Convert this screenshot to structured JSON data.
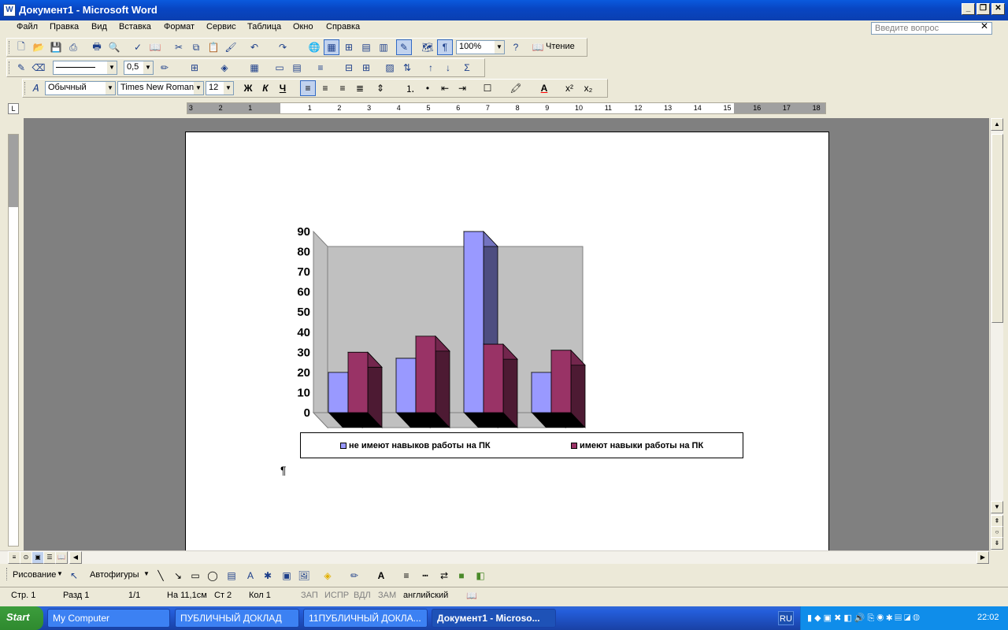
{
  "window": {
    "title": "Документ1 - Microsoft Word",
    "app_icon": "W"
  },
  "menu": [
    "Файл",
    "Правка",
    "Вид",
    "Вставка",
    "Формат",
    "Сервис",
    "Таблица",
    "Окно",
    "Справка"
  ],
  "help_search": {
    "placeholder": "Введите вопрос"
  },
  "toolbar_standard": {
    "zoom": "100%",
    "reading_label": "Чтение"
  },
  "toolbar_tables": {
    "line_weight": "0,5"
  },
  "toolbar_format": {
    "style": "Обычный",
    "font": "Times New Roman",
    "size": "12",
    "bold": "Ж",
    "italic": "К",
    "underline": "Ч"
  },
  "ruler_h_labels": [
    "3",
    "2",
    "1",
    "1",
    "2",
    "3",
    "4",
    "5",
    "6",
    "7",
    "8",
    "9",
    "10",
    "11",
    "12",
    "13",
    "14",
    "15",
    "16",
    "17",
    "18"
  ],
  "chart_data": {
    "type": "bar",
    "categories": [
      "",
      "",
      "",
      ""
    ],
    "series": [
      {
        "name": "не имеют навыков работы на ПК",
        "values": [
          20,
          27,
          90,
          20
        ],
        "color": "#9999ff"
      },
      {
        "name": "имеют навыки работы на ПК",
        "values": [
          30,
          38,
          34,
          31
        ],
        "color": "#993366"
      }
    ],
    "ylim": [
      0,
      90
    ],
    "yticks": [
      "0",
      "10",
      "20",
      "30",
      "40",
      "50",
      "60",
      "70",
      "80",
      "90"
    ],
    "legend_position": "bottom",
    "grid": false,
    "style": "3d"
  },
  "pilcrow": "¶",
  "drawbar": {
    "draw_label": "Рисование",
    "autoshapes_label": "Автофигуры"
  },
  "status": {
    "page": "Стр.  1",
    "section": "Разд  1",
    "pages": "1/1",
    "at": "На  11,1см",
    "line": "Ст  2",
    "col": "Кол  1",
    "rec": "ЗАП",
    "trk": "ИСПР",
    "ext": "ВДЛ",
    "ovr": "ЗАМ",
    "lang": "английский"
  },
  "taskbar": {
    "start": "Start",
    "tasks": [
      "My Computer",
      "ПУБЛИЧНЫЙ ДОКЛАД",
      "11ПУБЛИЧНЫЙ ДОКЛА...",
      "Документ1 - Microso..."
    ],
    "lang": "RU",
    "clock": "22:02"
  }
}
